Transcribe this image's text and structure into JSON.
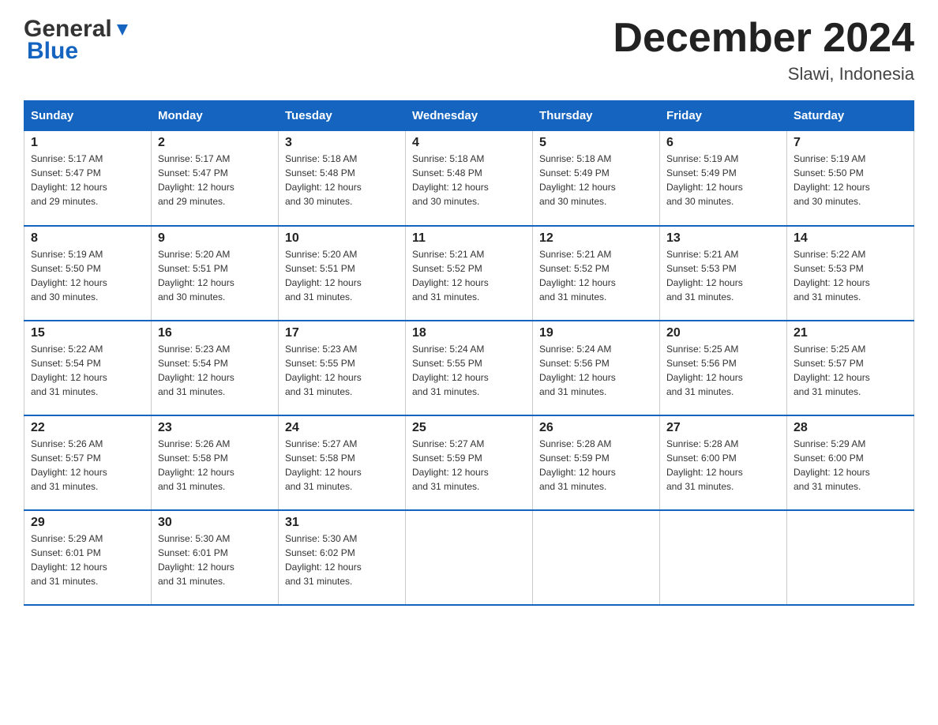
{
  "header": {
    "logo_general": "General",
    "logo_blue": "Blue",
    "month_title": "December 2024",
    "location": "Slawi, Indonesia"
  },
  "weekdays": [
    "Sunday",
    "Monday",
    "Tuesday",
    "Wednesday",
    "Thursday",
    "Friday",
    "Saturday"
  ],
  "weeks": [
    [
      {
        "day": "1",
        "sunrise": "5:17 AM",
        "sunset": "5:47 PM",
        "daylight": "12 hours and 29 minutes."
      },
      {
        "day": "2",
        "sunrise": "5:17 AM",
        "sunset": "5:47 PM",
        "daylight": "12 hours and 29 minutes."
      },
      {
        "day": "3",
        "sunrise": "5:18 AM",
        "sunset": "5:48 PM",
        "daylight": "12 hours and 30 minutes."
      },
      {
        "day": "4",
        "sunrise": "5:18 AM",
        "sunset": "5:48 PM",
        "daylight": "12 hours and 30 minutes."
      },
      {
        "day": "5",
        "sunrise": "5:18 AM",
        "sunset": "5:49 PM",
        "daylight": "12 hours and 30 minutes."
      },
      {
        "day": "6",
        "sunrise": "5:19 AM",
        "sunset": "5:49 PM",
        "daylight": "12 hours and 30 minutes."
      },
      {
        "day": "7",
        "sunrise": "5:19 AM",
        "sunset": "5:50 PM",
        "daylight": "12 hours and 30 minutes."
      }
    ],
    [
      {
        "day": "8",
        "sunrise": "5:19 AM",
        "sunset": "5:50 PM",
        "daylight": "12 hours and 30 minutes."
      },
      {
        "day": "9",
        "sunrise": "5:20 AM",
        "sunset": "5:51 PM",
        "daylight": "12 hours and 30 minutes."
      },
      {
        "day": "10",
        "sunrise": "5:20 AM",
        "sunset": "5:51 PM",
        "daylight": "12 hours and 31 minutes."
      },
      {
        "day": "11",
        "sunrise": "5:21 AM",
        "sunset": "5:52 PM",
        "daylight": "12 hours and 31 minutes."
      },
      {
        "day": "12",
        "sunrise": "5:21 AM",
        "sunset": "5:52 PM",
        "daylight": "12 hours and 31 minutes."
      },
      {
        "day": "13",
        "sunrise": "5:21 AM",
        "sunset": "5:53 PM",
        "daylight": "12 hours and 31 minutes."
      },
      {
        "day": "14",
        "sunrise": "5:22 AM",
        "sunset": "5:53 PM",
        "daylight": "12 hours and 31 minutes."
      }
    ],
    [
      {
        "day": "15",
        "sunrise": "5:22 AM",
        "sunset": "5:54 PM",
        "daylight": "12 hours and 31 minutes."
      },
      {
        "day": "16",
        "sunrise": "5:23 AM",
        "sunset": "5:54 PM",
        "daylight": "12 hours and 31 minutes."
      },
      {
        "day": "17",
        "sunrise": "5:23 AM",
        "sunset": "5:55 PM",
        "daylight": "12 hours and 31 minutes."
      },
      {
        "day": "18",
        "sunrise": "5:24 AM",
        "sunset": "5:55 PM",
        "daylight": "12 hours and 31 minutes."
      },
      {
        "day": "19",
        "sunrise": "5:24 AM",
        "sunset": "5:56 PM",
        "daylight": "12 hours and 31 minutes."
      },
      {
        "day": "20",
        "sunrise": "5:25 AM",
        "sunset": "5:56 PM",
        "daylight": "12 hours and 31 minutes."
      },
      {
        "day": "21",
        "sunrise": "5:25 AM",
        "sunset": "5:57 PM",
        "daylight": "12 hours and 31 minutes."
      }
    ],
    [
      {
        "day": "22",
        "sunrise": "5:26 AM",
        "sunset": "5:57 PM",
        "daylight": "12 hours and 31 minutes."
      },
      {
        "day": "23",
        "sunrise": "5:26 AM",
        "sunset": "5:58 PM",
        "daylight": "12 hours and 31 minutes."
      },
      {
        "day": "24",
        "sunrise": "5:27 AM",
        "sunset": "5:58 PM",
        "daylight": "12 hours and 31 minutes."
      },
      {
        "day": "25",
        "sunrise": "5:27 AM",
        "sunset": "5:59 PM",
        "daylight": "12 hours and 31 minutes."
      },
      {
        "day": "26",
        "sunrise": "5:28 AM",
        "sunset": "5:59 PM",
        "daylight": "12 hours and 31 minutes."
      },
      {
        "day": "27",
        "sunrise": "5:28 AM",
        "sunset": "6:00 PM",
        "daylight": "12 hours and 31 minutes."
      },
      {
        "day": "28",
        "sunrise": "5:29 AM",
        "sunset": "6:00 PM",
        "daylight": "12 hours and 31 minutes."
      }
    ],
    [
      {
        "day": "29",
        "sunrise": "5:29 AM",
        "sunset": "6:01 PM",
        "daylight": "12 hours and 31 minutes."
      },
      {
        "day": "30",
        "sunrise": "5:30 AM",
        "sunset": "6:01 PM",
        "daylight": "12 hours and 31 minutes."
      },
      {
        "day": "31",
        "sunrise": "5:30 AM",
        "sunset": "6:02 PM",
        "daylight": "12 hours and 31 minutes."
      },
      null,
      null,
      null,
      null
    ]
  ],
  "labels": {
    "sunrise": "Sunrise:",
    "sunset": "Sunset:",
    "daylight": "Daylight:"
  }
}
